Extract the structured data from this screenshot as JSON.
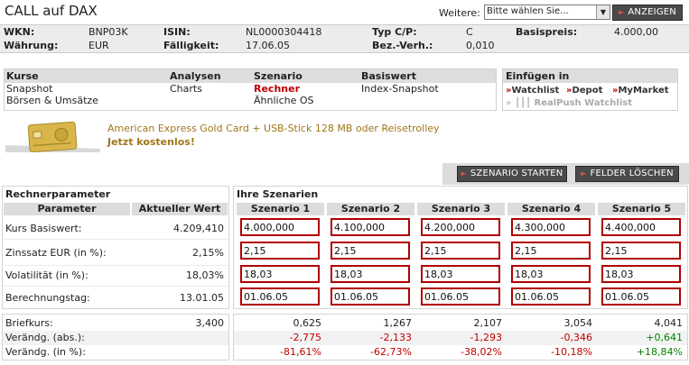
{
  "title": "CALL auf DAX",
  "header": {
    "weitere_label": "Weitere:",
    "weitere_selected": "Bitte wählen Sie...",
    "anzeigen_label": "ANZEIGEN"
  },
  "info": {
    "wkn_label": "WKN:",
    "wkn": "BNP03K",
    "isin_label": "ISIN:",
    "isin": "NL0000304418",
    "typ_label": "Typ C/P:",
    "typ": "C",
    "basispreis_label": "Basispreis:",
    "basispreis": "4.000,00",
    "waehrung_label": "Währung:",
    "waehrung": "EUR",
    "faelligkeit_label": "Fälligkeit:",
    "faelligkeit": "17.06.05",
    "bezverh_label": "Bez.-Verh.:",
    "bezverh": "0,010"
  },
  "nav": {
    "kurse": {
      "head": "Kurse",
      "links": [
        "Snapshot",
        "Börsen & Umsätze"
      ]
    },
    "analysen": {
      "head": "Analysen",
      "links": [
        "Charts"
      ]
    },
    "szenario": {
      "head": "Szenario",
      "links": [
        "Rechner",
        "Ähnliche OS"
      ]
    },
    "basiswert": {
      "head": "Basiswert",
      "links": [
        "Index-Snapshot"
      ]
    }
  },
  "einfuegen": {
    "head": "Einfügen in",
    "watchlist": "Watchlist",
    "depot": "Depot",
    "mymarket": "MyMarket",
    "realpush": "RealPush Watchlist"
  },
  "promo": {
    "line1": "American Express Gold Card + USB-Stick 128 MB oder Reisetrolley",
    "line2": "Jetzt kostenlos!"
  },
  "actions": {
    "start": "SZENARIO STARTEN",
    "clear": "FELDER LÖSCHEN"
  },
  "rechner": {
    "title": "Rechnerparameter",
    "col_param": "Parameter",
    "col_value": "Aktueller Wert",
    "rows": [
      {
        "label": "Kurs Basiswert:",
        "value": "4.209,410"
      },
      {
        "label": "Zinssatz EUR (in %):",
        "value": "2,15%"
      },
      {
        "label": "Volatilität (in %):",
        "value": "18,03%"
      },
      {
        "label": "Berechnungstag:",
        "value": "13.01.05"
      }
    ]
  },
  "szenarien": {
    "title": "Ihre Szenarien",
    "columns": [
      "Szenario 1",
      "Szenario 2",
      "Szenario 3",
      "Szenario 4",
      "Szenario 5"
    ],
    "inputs": [
      [
        "4.000,000",
        "4.100,000",
        "4.200,000",
        "4.300,000",
        "4.400,000"
      ],
      [
        "2,15",
        "2,15",
        "2,15",
        "2,15",
        "2,15"
      ],
      [
        "18,03",
        "18,03",
        "18,03",
        "18,03",
        "18,03"
      ],
      [
        "01.06.05",
        "01.06.05",
        "01.06.05",
        "01.06.05",
        "01.06.05"
      ]
    ]
  },
  "results": {
    "labels": [
      "Briefkurs:",
      "Verändg. (abs.):",
      "Verändg. (in %):"
    ],
    "current_brief": "3,400",
    "brief": [
      "0,625",
      "1,267",
      "2,107",
      "3,054",
      "4,041"
    ],
    "abs": [
      "-2,775",
      "-2,133",
      "-1,293",
      "-0,346",
      "+0,641"
    ],
    "pct": [
      "-81,61%",
      "-62,73%",
      "-38,02%",
      "-10,18%",
      "+18,84%"
    ]
  }
}
